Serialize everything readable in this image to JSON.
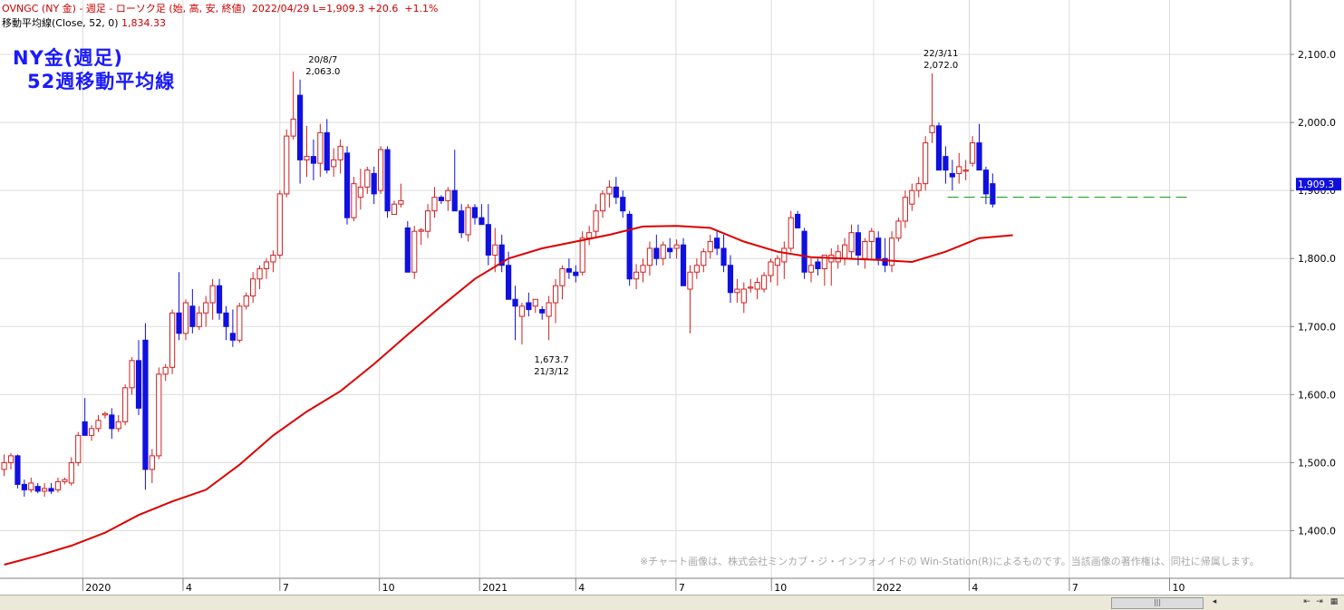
{
  "header": {
    "line1": "OVNGC (NY 金) - 週足 - ローソク足 (始, 高, 安, 終値)  2022/04/29 L=1,909.3 +20.6  +1.1%",
    "ma_label": "移動平均線(Close, 52, 0)",
    "ma_value": "1,834.33"
  },
  "title_lines": [
    "NY金(週足)",
    "52週移動平均線"
  ],
  "copyright": "※チャート画像は、株式会社ミンカブ・ジ・インフォノイドの Win-Station(R)によるものです。当該画像の著作権は、同社に帰属します。",
  "colors": {
    "up": "#d02020",
    "down": "#1010e0",
    "ma": "#dd0000",
    "grid": "#dcdcdc",
    "last_price_box": "#1010e0",
    "dashed_line": "#009900"
  },
  "chart_data": {
    "type": "candlestick",
    "ylim": [
      1330,
      2180
    ],
    "yticks": [
      1400,
      1500,
      1600,
      1700,
      1800,
      1900,
      2000,
      2100
    ],
    "ytick_labels": [
      "1,400.0",
      "1,500.0",
      "1,600.0",
      "1,700.0",
      "1,800.0",
      "1,900.0",
      "2,000.0",
      "2,100.0"
    ],
    "xlim": [
      0,
      182
    ],
    "xticks": [
      {
        "i": 11.7,
        "label": "2020"
      },
      {
        "i": 26.6,
        "label": "4"
      },
      {
        "i": 41.0,
        "label": "7"
      },
      {
        "i": 55.8,
        "label": "10"
      },
      {
        "i": 70.7,
        "label": "2021"
      },
      {
        "i": 85.0,
        "label": "4"
      },
      {
        "i": 99.9,
        "label": "7"
      },
      {
        "i": 114.1,
        "label": "10"
      },
      {
        "i": 129.3,
        "label": "2022"
      },
      {
        "i": 143.5,
        "label": "4"
      },
      {
        "i": 158.4,
        "label": "7"
      },
      {
        "i": 173.3,
        "label": "10"
      }
    ],
    "last_price": "1,909.3",
    "last_price_value": 1909.3,
    "dashed_level": 1890,
    "dashed_range": [
      140.3,
      176
    ],
    "candles": [
      [
        1490,
        1512,
        1480,
        1500
      ],
      [
        1500,
        1514,
        1490,
        1510
      ],
      [
        1510,
        1512,
        1462,
        1468
      ],
      [
        1468,
        1475,
        1450,
        1460
      ],
      [
        1460,
        1478,
        1456,
        1470
      ],
      [
        1465,
        1470,
        1455,
        1458
      ],
      [
        1458,
        1470,
        1450,
        1462
      ],
      [
        1462,
        1470,
        1454,
        1458
      ],
      [
        1460,
        1478,
        1456,
        1472
      ],
      [
        1472,
        1478,
        1468,
        1475
      ],
      [
        1470,
        1508,
        1466,
        1500
      ],
      [
        1500,
        1545,
        1495,
        1540
      ],
      [
        1560,
        1595,
        1550,
        1540
      ],
      [
        1540,
        1555,
        1532,
        1550
      ],
      [
        1550,
        1570,
        1545,
        1562
      ],
      [
        1570,
        1575,
        1565,
        1572
      ],
      [
        1570,
        1580,
        1535,
        1550
      ],
      [
        1550,
        1570,
        1545,
        1560
      ],
      [
        1560,
        1615,
        1555,
        1610
      ],
      [
        1610,
        1655,
        1600,
        1650
      ],
      [
        1650,
        1680,
        1570,
        1580
      ],
      [
        1680,
        1705,
        1460,
        1490
      ],
      [
        1490,
        1520,
        1470,
        1510
      ],
      [
        1510,
        1640,
        1505,
        1630
      ],
      [
        1630,
        1645,
        1620,
        1640
      ],
      [
        1640,
        1725,
        1630,
        1720
      ],
      [
        1720,
        1780,
        1680,
        1690
      ],
      [
        1690,
        1740,
        1680,
        1735
      ],
      [
        1730,
        1755,
        1690,
        1700
      ],
      [
        1700,
        1730,
        1695,
        1720
      ],
      [
        1720,
        1745,
        1700,
        1735
      ],
      [
        1735,
        1770,
        1710,
        1760
      ],
      [
        1760,
        1770,
        1710,
        1720
      ],
      [
        1720,
        1730,
        1680,
        1700
      ],
      [
        1690,
        1725,
        1670,
        1680
      ],
      [
        1680,
        1735,
        1676,
        1730
      ],
      [
        1730,
        1750,
        1725,
        1745
      ],
      [
        1745,
        1780,
        1735,
        1770
      ],
      [
        1770,
        1790,
        1755,
        1785
      ],
      [
        1785,
        1800,
        1770,
        1795
      ],
      [
        1795,
        1812,
        1780,
        1805
      ],
      [
        1805,
        1900,
        1800,
        1895
      ],
      [
        1895,
        1990,
        1890,
        1980
      ],
      [
        1980,
        2075,
        1975,
        2005
      ],
      [
        2040,
        2063,
        1910,
        1945
      ],
      [
        1945,
        1995,
        1920,
        1950
      ],
      [
        1950,
        1975,
        1915,
        1940
      ],
      [
        1940,
        1998,
        1920,
        1985
      ],
      [
        1985,
        2005,
        1925,
        1930
      ],
      [
        1935,
        1962,
        1920,
        1945
      ],
      [
        1945,
        1975,
        1925,
        1965
      ],
      [
        1955,
        1965,
        1850,
        1860
      ],
      [
        1860,
        1920,
        1855,
        1910
      ],
      [
        1890,
        1932,
        1872,
        1905
      ],
      [
        1905,
        1935,
        1895,
        1930
      ],
      [
        1925,
        1935,
        1880,
        1895
      ],
      [
        1900,
        1965,
        1895,
        1960
      ],
      [
        1960,
        1965,
        1860,
        1870
      ],
      [
        1865,
        1885,
        1870,
        1880
      ],
      [
        1880,
        1910,
        1875,
        1885
      ],
      [
        1845,
        1855,
        1790,
        1780
      ],
      [
        1780,
        1848,
        1770,
        1840
      ],
      [
        1840,
        1845,
        1820,
        1842
      ],
      [
        1840,
        1880,
        1830,
        1870
      ],
      [
        1870,
        1905,
        1860,
        1890
      ],
      [
        1890,
        1893,
        1880,
        1885
      ],
      [
        1885,
        1905,
        1870,
        1900
      ],
      [
        1900,
        1960,
        1880,
        1870
      ],
      [
        1870,
        1880,
        1830,
        1838
      ],
      [
        1835,
        1880,
        1825,
        1875
      ],
      [
        1875,
        1880,
        1850,
        1860
      ],
      [
        1860,
        1880,
        1850,
        1850
      ],
      [
        1850,
        1880,
        1790,
        1805
      ],
      [
        1805,
        1845,
        1780,
        1820
      ],
      [
        1820,
        1835,
        1780,
        1790
      ],
      [
        1790,
        1810,
        1740,
        1740
      ],
      [
        1740,
        1760,
        1680,
        1730
      ],
      [
        1715,
        1735,
        1673.7,
        1730
      ],
      [
        1735,
        1750,
        1715,
        1725
      ],
      [
        1730,
        1740,
        1720,
        1740
      ],
      [
        1725,
        1730,
        1710,
        1720
      ],
      [
        1715,
        1745,
        1680,
        1735
      ],
      [
        1735,
        1770,
        1705,
        1760
      ],
      [
        1760,
        1790,
        1740,
        1785
      ],
      [
        1785,
        1800,
        1770,
        1780
      ],
      [
        1780,
        1790,
        1765,
        1775
      ],
      [
        1780,
        1840,
        1775,
        1830
      ],
      [
        1830,
        1848,
        1820,
        1838
      ],
      [
        1840,
        1880,
        1830,
        1870
      ],
      [
        1870,
        1900,
        1860,
        1895
      ],
      [
        1895,
        1915,
        1875,
        1905
      ],
      [
        1905,
        1920,
        1880,
        1890
      ],
      [
        1890,
        1900,
        1860,
        1870
      ],
      [
        1865,
        1870,
        1760,
        1770
      ],
      [
        1770,
        1792,
        1755,
        1780
      ],
      [
        1780,
        1800,
        1765,
        1790
      ],
      [
        1790,
        1825,
        1775,
        1815
      ],
      [
        1815,
        1835,
        1790,
        1800
      ],
      [
        1800,
        1825,
        1790,
        1820
      ],
      [
        1815,
        1830,
        1800,
        1810
      ],
      [
        1815,
        1828,
        1800,
        1820
      ],
      [
        1820,
        1830,
        1760,
        1760
      ],
      [
        1755,
        1790,
        1690,
        1780
      ],
      [
        1780,
        1800,
        1770,
        1790
      ],
      [
        1790,
        1815,
        1780,
        1810
      ],
      [
        1810,
        1835,
        1800,
        1825
      ],
      [
        1830,
        1840,
        1805,
        1815
      ],
      [
        1815,
        1835,
        1780,
        1790
      ],
      [
        1790,
        1805,
        1735,
        1750
      ],
      [
        1750,
        1770,
        1735,
        1755
      ],
      [
        1735,
        1765,
        1720,
        1755
      ],
      [
        1757,
        1770,
        1750,
        1758
      ],
      [
        1755,
        1772,
        1740,
        1765
      ],
      [
        1755,
        1780,
        1750,
        1775
      ],
      [
        1775,
        1800,
        1765,
        1795
      ],
      [
        1790,
        1805,
        1760,
        1800
      ],
      [
        1795,
        1825,
        1770,
        1815
      ],
      [
        1815,
        1870,
        1810,
        1860
      ],
      [
        1865,
        1870,
        1845,
        1845
      ],
      [
        1840,
        1845,
        1770,
        1780
      ],
      [
        1780,
        1800,
        1765,
        1790
      ],
      [
        1795,
        1800,
        1775,
        1785
      ],
      [
        1785,
        1805,
        1760,
        1805
      ],
      [
        1795,
        1815,
        1760,
        1805
      ],
      [
        1795,
        1820,
        1785,
        1810
      ],
      [
        1800,
        1830,
        1790,
        1820
      ],
      [
        1810,
        1850,
        1800,
        1838
      ],
      [
        1838,
        1850,
        1790,
        1805
      ],
      [
        1800,
        1830,
        1785,
        1825
      ],
      [
        1825,
        1845,
        1800,
        1840
      ],
      [
        1830,
        1840,
        1790,
        1800
      ],
      [
        1800,
        1830,
        1780,
        1790
      ],
      [
        1790,
        1840,
        1780,
        1830
      ],
      [
        1830,
        1860,
        1825,
        1855
      ],
      [
        1855,
        1900,
        1845,
        1890
      ],
      [
        1880,
        1910,
        1870,
        1900
      ],
      [
        1900,
        1920,
        1890,
        1910
      ],
      [
        1910,
        1980,
        1900,
        1970
      ],
      [
        1985,
        2072,
        1970,
        1995
      ],
      [
        1995,
        2000,
        1935,
        1930
      ],
      [
        1950,
        1965,
        1910,
        1930
      ],
      [
        1925,
        1945,
        1900,
        1920
      ],
      [
        1925,
        1955,
        1910,
        1935
      ],
      [
        1930,
        1945,
        1915,
        1930
      ],
      [
        1940,
        1980,
        1935,
        1970
      ],
      [
        1970,
        1998,
        1960,
        1930
      ],
      [
        1930,
        1935,
        1880,
        1895
      ],
      [
        1910,
        1925,
        1875,
        1880
      ]
    ],
    "ma": [
      [
        0,
        1350
      ],
      [
        5,
        1363
      ],
      [
        10,
        1378
      ],
      [
        15,
        1397
      ],
      [
        20,
        1423
      ],
      [
        25,
        1443
      ],
      [
        30,
        1460
      ],
      [
        35,
        1497
      ],
      [
        40,
        1540
      ],
      [
        45,
        1575
      ],
      [
        50,
        1605
      ],
      [
        55,
        1645
      ],
      [
        60,
        1688
      ],
      [
        65,
        1730
      ],
      [
        70,
        1770
      ],
      [
        75,
        1800
      ],
      [
        80,
        1815
      ],
      [
        85,
        1825
      ],
      [
        90,
        1835
      ],
      [
        95,
        1847
      ],
      [
        100,
        1848
      ],
      [
        105,
        1845
      ],
      [
        110,
        1825
      ],
      [
        115,
        1810
      ],
      [
        120,
        1802
      ],
      [
        125,
        1800
      ],
      [
        130,
        1798
      ],
      [
        135,
        1795
      ],
      [
        140,
        1810
      ],
      [
        145,
        1830
      ],
      [
        150,
        1834.33
      ]
    ],
    "annotations": [
      {
        "i": 47.4,
        "value": 2063,
        "pos": "above",
        "lines": [
          "20/8/7",
          "2,063.0"
        ]
      },
      {
        "i": 139.3,
        "value": 2072,
        "pos": "above",
        "lines": [
          "22/3/11",
          "2,072.0"
        ]
      },
      {
        "i": 81.4,
        "value": 1673.7,
        "pos": "below",
        "lines": [
          "1,673.7",
          "21/3/12"
        ]
      }
    ]
  },
  "scrollbar": {
    "thumb_glyph": "|||"
  }
}
